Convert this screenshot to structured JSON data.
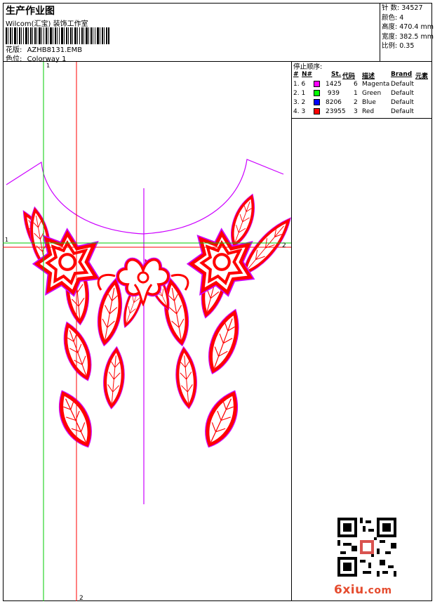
{
  "header": {
    "title": "生产作业图",
    "company": "Wilcom(汇宝) 装饰工作室",
    "design_label": "花版:",
    "design_value": "AZHB8131.EMB",
    "color_label": "色位:",
    "color_value": "Colorway 1"
  },
  "specs": [
    {
      "label": "针 数:",
      "value": "34527"
    },
    {
      "label": "颜色:",
      "value": "4"
    },
    {
      "label": "高度:",
      "value": "470.4 mm"
    },
    {
      "label": "宽度:",
      "value": "382.5 mm"
    },
    {
      "label": "比例:",
      "value": "0.35"
    }
  ],
  "stop_sequence": {
    "title": "停止顺序:",
    "columns": [
      "#",
      "N#",
      "St.",
      "代码",
      "描述",
      "Brand",
      "元素"
    ],
    "rows": [
      {
        "index": "1. 6",
        "color": "#ff00ff",
        "stitches": "1425",
        "code": "6",
        "desc": "Magenta",
        "brand": "Default"
      },
      {
        "index": "2. 1",
        "color": "#00ff00",
        "stitches": "939",
        "code": "1",
        "desc": "Green",
        "brand": "Default"
      },
      {
        "index": "3. 2",
        "color": "#0000ff",
        "stitches": "8206",
        "code": "2",
        "desc": "Blue",
        "brand": "Default"
      },
      {
        "index": "4. 3",
        "color": "#ff0000",
        "stitches": "23955",
        "code": "3",
        "desc": "Red",
        "brand": "Default"
      }
    ]
  },
  "guides": {
    "green_label_top": "1",
    "green_label_left": "1",
    "red_label_right": "2",
    "red_label_bottom": "2"
  },
  "watermark": {
    "text": "6xiu",
    "suffix": ".com"
  },
  "colors": {
    "red": "#ff0000",
    "green": "#00cc00",
    "magenta": "#cc00ff",
    "outline": "#cc00ff"
  }
}
